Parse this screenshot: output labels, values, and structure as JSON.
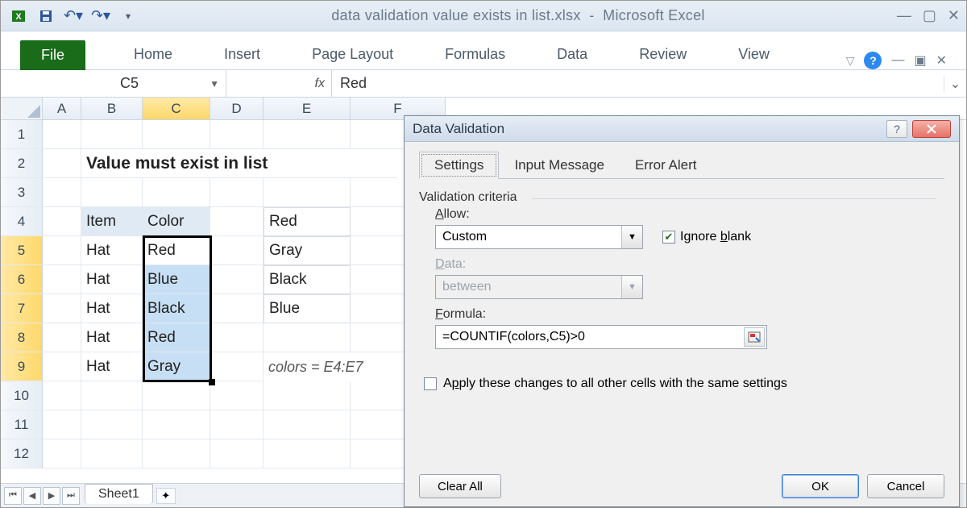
{
  "titlebar": {
    "document": "data validation value exists in list.xlsx",
    "app": "Microsoft Excel"
  },
  "ribbon": {
    "file": "File",
    "tabs": [
      "Home",
      "Insert",
      "Page Layout",
      "Formulas",
      "Data",
      "Review",
      "View"
    ]
  },
  "formula_bar": {
    "name_box": "C5",
    "fx": "fx",
    "value": "Red"
  },
  "columns": [
    "A",
    "B",
    "C",
    "D",
    "E",
    "F"
  ],
  "rows": [
    "1",
    "2",
    "3",
    "4",
    "5",
    "6",
    "7",
    "8",
    "9",
    "10",
    "11",
    "12"
  ],
  "sheet": {
    "heading": "Value must exist in list",
    "col_b_header": "Item",
    "col_c_header": "Color",
    "items": [
      "Hat",
      "Hat",
      "Hat",
      "Hat",
      "Hat"
    ],
    "colors": [
      "Red",
      "Blue",
      "Black",
      "Red",
      "Gray"
    ],
    "list": [
      "Red",
      "Gray",
      "Black",
      "Blue"
    ],
    "note": "colors = E4:E7",
    "tab": "Sheet1"
  },
  "dialog": {
    "title": "Data Validation",
    "tabs": [
      "Settings",
      "Input Message",
      "Error Alert"
    ],
    "group": "Validation criteria",
    "allow_label": "Allow:",
    "allow_value": "Custom",
    "ignore_blank": "Ignore blank",
    "data_label": "Data:",
    "data_value": "between",
    "formula_label": "Formula:",
    "formula_value": "=COUNTIF(colors,C5)>0",
    "apply_all": "Apply these changes to all other cells with the same settings",
    "clear": "Clear All",
    "ok": "OK",
    "cancel": "Cancel"
  }
}
